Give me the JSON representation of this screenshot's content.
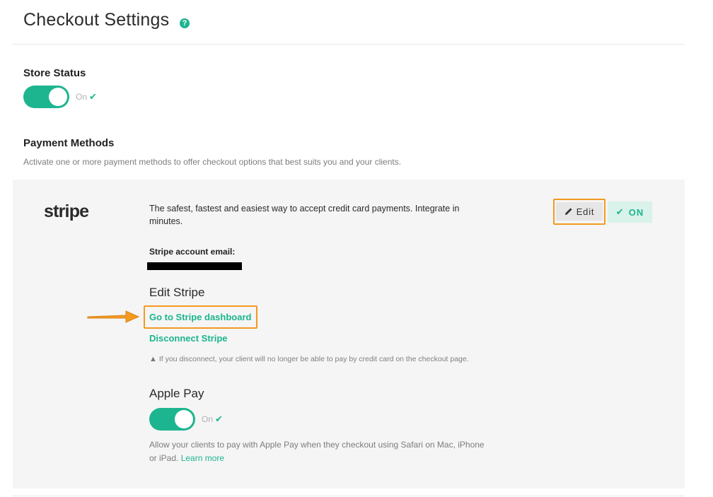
{
  "header": {
    "title": "Checkout Settings",
    "help_icon_glyph": "?"
  },
  "store_status": {
    "heading": "Store Status",
    "toggle_state": "On",
    "enabled": true
  },
  "payment_methods": {
    "heading": "Payment Methods",
    "description": "Activate one or more payment methods to offer checkout options that best suits you and your clients."
  },
  "stripe": {
    "logo_text": "stripe",
    "description": "The safest, fastest and easiest way to accept credit card payments. Integrate in minutes.",
    "account_email_label": "Stripe account email:",
    "edit_heading": "Edit Stripe",
    "dashboard_link": "Go to Stripe dashboard",
    "disconnect_link": "Disconnect Stripe",
    "disconnect_warning": "If you disconnect, your client will no longer be able to pay by credit card on the checkout page.",
    "edit_button_label": "Edit",
    "status_badge": "ON"
  },
  "apple_pay": {
    "heading": "Apple Pay",
    "toggle_state": "On",
    "enabled": true,
    "description": "Allow your clients to pay with Apple Pay when they checkout using Safari on Mac, iPhone or iPad.",
    "learn_more": "Learn more"
  },
  "icons": {
    "help": "question-circle-icon",
    "checkmark": "checkmark-icon",
    "pencil": "pencil-icon",
    "warning": "warning-triangle-icon",
    "arrow": "arrow-right-annotation"
  },
  "colors": {
    "accent": "#1cb58f",
    "highlight_annotation": "#f39a1f",
    "panel_background": "#f5f5f5",
    "badge_background": "#d9f2ea"
  }
}
